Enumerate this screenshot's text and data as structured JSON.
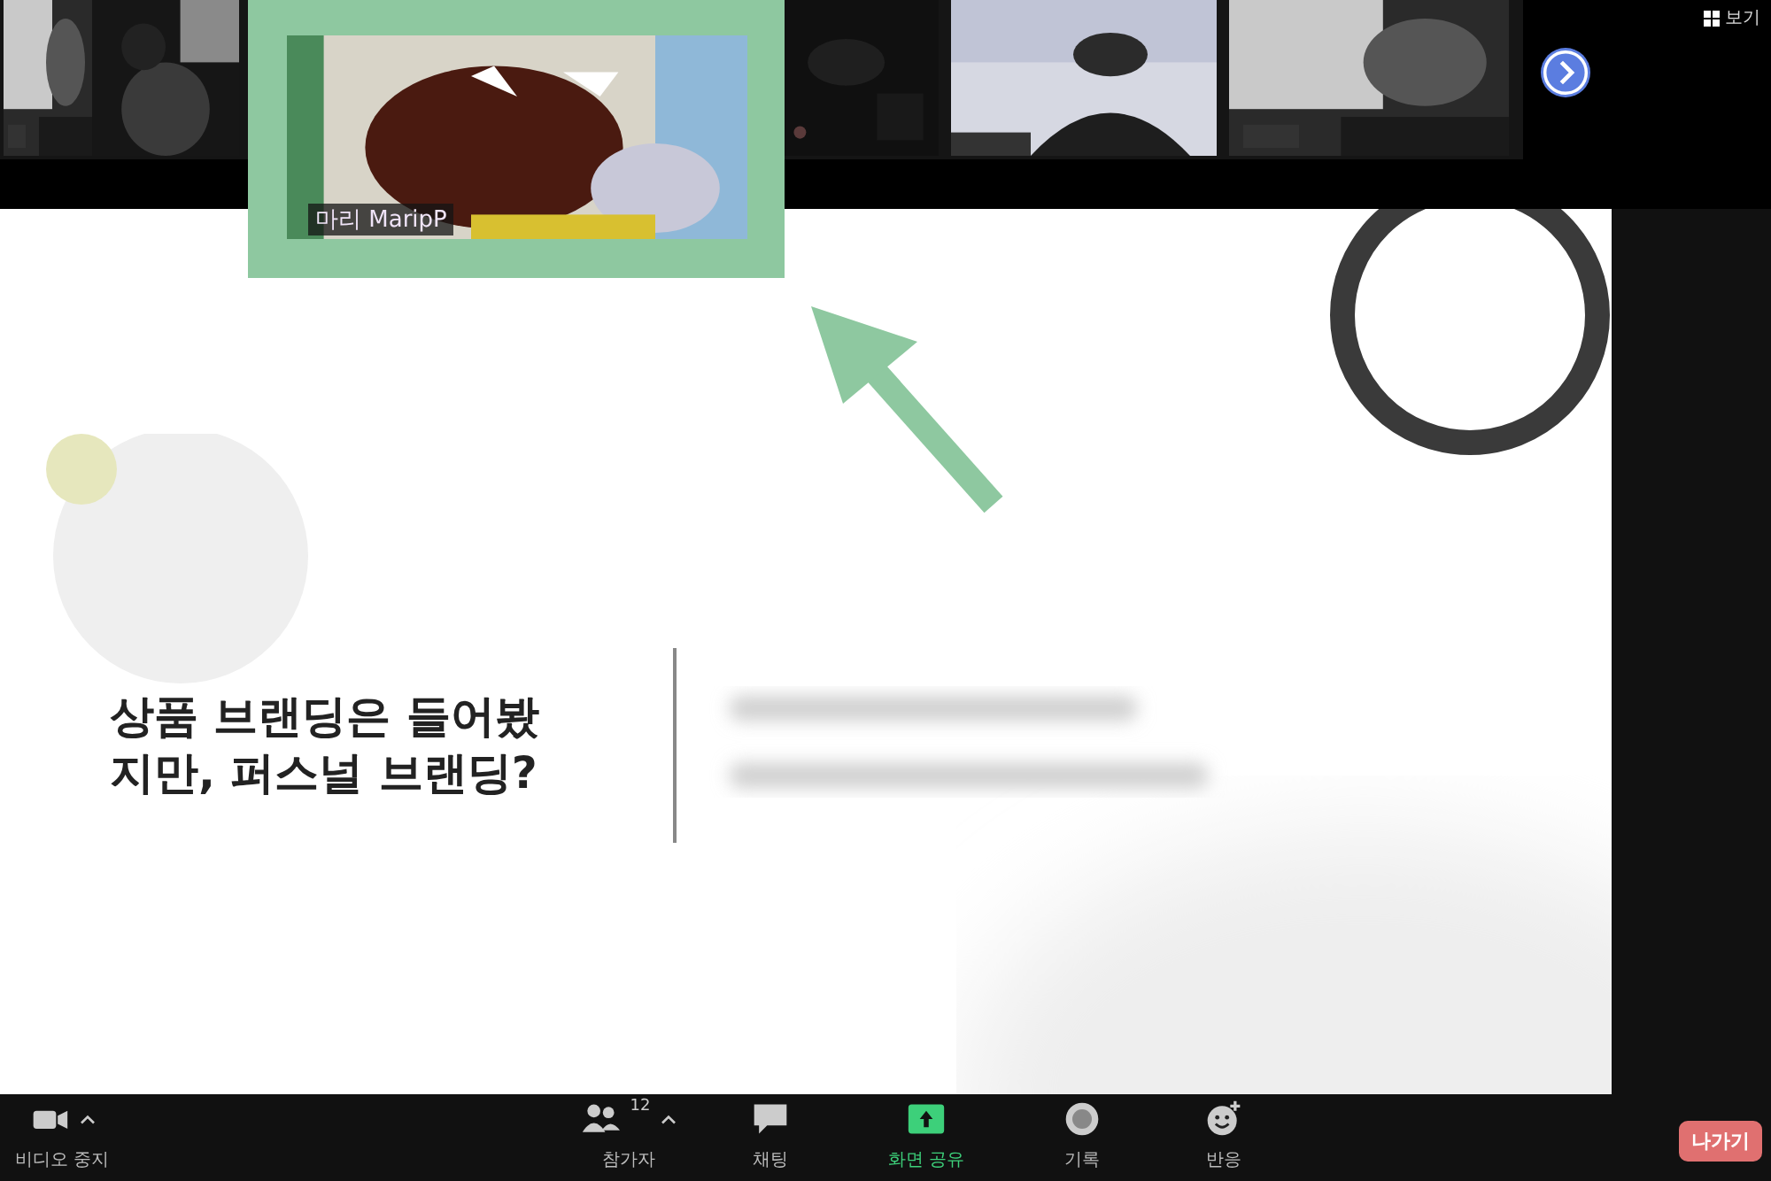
{
  "gallery": {
    "featured_tile": {
      "name": "마리 MaripP",
      "highlighted": true
    }
  },
  "view_button": {
    "label": "보기"
  },
  "slide": {
    "title_lines": [
      "상품 브랜딩은 들어봤",
      "지만, 퍼스널 브랜딩?"
    ]
  },
  "toolbar": {
    "items": [
      {
        "kind": "video",
        "label": "비디오 중지",
        "caret": true
      },
      {
        "kind": "participants",
        "label": "참가자",
        "count": "12",
        "caret": true
      },
      {
        "kind": "chat",
        "label": "채팅",
        "caret": false
      },
      {
        "kind": "share",
        "label": "화면 공유",
        "caret": false,
        "active": true
      },
      {
        "kind": "record",
        "label": "기록",
        "caret": false
      },
      {
        "kind": "reaction",
        "label": "반응",
        "caret": false
      }
    ],
    "leave_button": {
      "label": "나가기"
    }
  }
}
